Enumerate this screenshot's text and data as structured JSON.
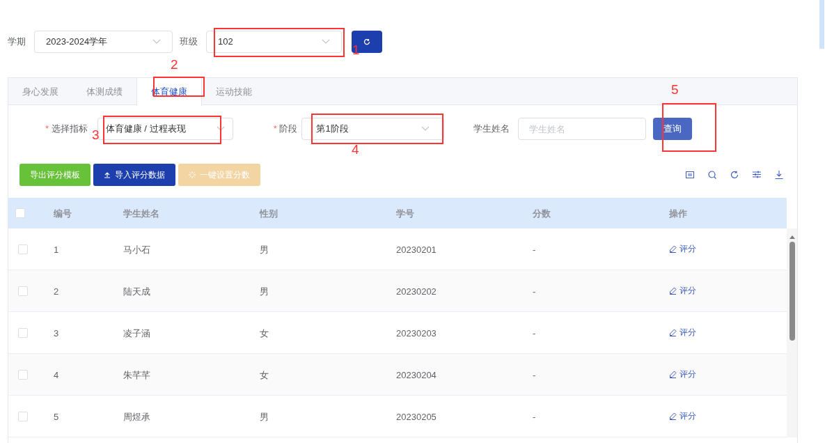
{
  "filters": {
    "term": {
      "label": "学期",
      "value": "2023-2024学年"
    },
    "class": {
      "label": "班级",
      "value": "102"
    }
  },
  "tabs": [
    {
      "label": "身心发展",
      "selected": false
    },
    {
      "label": "体测成绩",
      "selected": false
    },
    {
      "label": "体育健康",
      "selected": true
    },
    {
      "label": "运动技能",
      "selected": false
    }
  ],
  "query": {
    "indicator": {
      "required_mark": "*",
      "label": "选择指标",
      "value": "体育健康 / 过程表现"
    },
    "stage": {
      "required_mark": "*",
      "label": "阶段",
      "value": "第1阶段"
    },
    "student_name": {
      "label": "学生姓名",
      "placeholder": "学生姓名"
    },
    "button": "查询"
  },
  "actions": [
    {
      "label": "导出评分模板",
      "kind": "export",
      "disabled": false
    },
    {
      "label": "导入评分数据",
      "kind": "import",
      "disabled": false
    },
    {
      "label": "一键设置分数",
      "kind": "auto",
      "disabled": true
    }
  ],
  "table": {
    "select_all_checked": false,
    "columns": [
      "编号",
      "学生姓名",
      "性别",
      "学号",
      "分数",
      "操作"
    ],
    "rows": [
      {
        "id": "1",
        "name": "马小石",
        "gender": "男",
        "student_no": "20230201",
        "score": "-",
        "action": "评分",
        "checked": false
      },
      {
        "id": "2",
        "name": "陆天成",
        "gender": "男",
        "student_no": "20230202",
        "score": "-",
        "action": "评分",
        "checked": false
      },
      {
        "id": "3",
        "name": "凌子涵",
        "gender": "女",
        "student_no": "20230203",
        "score": "-",
        "action": "评分",
        "checked": false
      },
      {
        "id": "4",
        "name": "朱芊芊",
        "gender": "女",
        "student_no": "20230204",
        "score": "-",
        "action": "评分",
        "checked": false
      },
      {
        "id": "5",
        "name": "周煜承",
        "gender": "男",
        "student_no": "20230205",
        "score": "-",
        "action": "评分",
        "checked": false
      }
    ]
  },
  "annotations": [
    {
      "label": "1"
    },
    {
      "label": "2"
    },
    {
      "label": "3"
    },
    {
      "label": "4"
    },
    {
      "label": "5"
    }
  ]
}
